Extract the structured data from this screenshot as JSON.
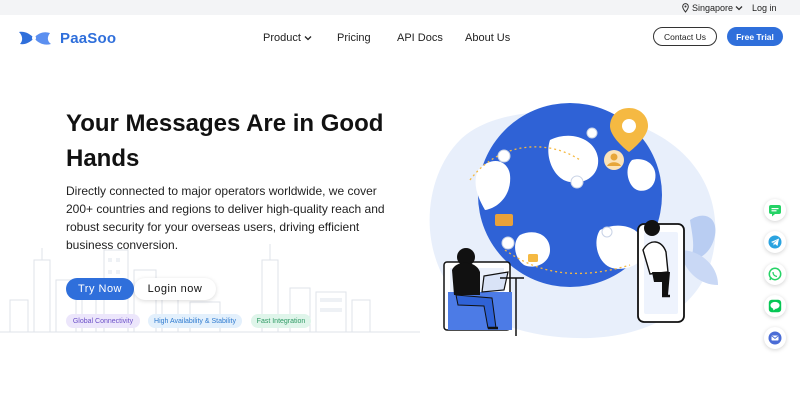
{
  "topbar": {
    "region": "Singapore",
    "login": "Log in"
  },
  "brand": {
    "name": "PaaSoo"
  },
  "nav": {
    "product": "Product",
    "pricing": "Pricing",
    "api_docs": "API Docs",
    "about": "About Us"
  },
  "header_buttons": {
    "contact": "Contact Us",
    "trial": "Free Trial"
  },
  "hero": {
    "title": "Your Messages Are in Good Hands",
    "description": "Directly connected to major operators worldwide, we cover 200+ countries and regions to deliver high-quality reach and robust security for your overseas users, driving efficient business conversion.",
    "try_now": "Try Now",
    "login_now": "Login now",
    "tags": [
      "Global Connectivity",
      "High Availability & Stability",
      "Fast Integration"
    ]
  },
  "sidebar_icons": [
    "message-icon",
    "telegram-icon",
    "whatsapp-icon",
    "line-icon",
    "email-icon"
  ],
  "colors": {
    "brand_blue": "#2f6fdb",
    "whatsapp_green": "#25d366",
    "telegram_blue": "#2aa3e0",
    "line_green": "#06c755",
    "pin_orange": "#f5b942"
  }
}
